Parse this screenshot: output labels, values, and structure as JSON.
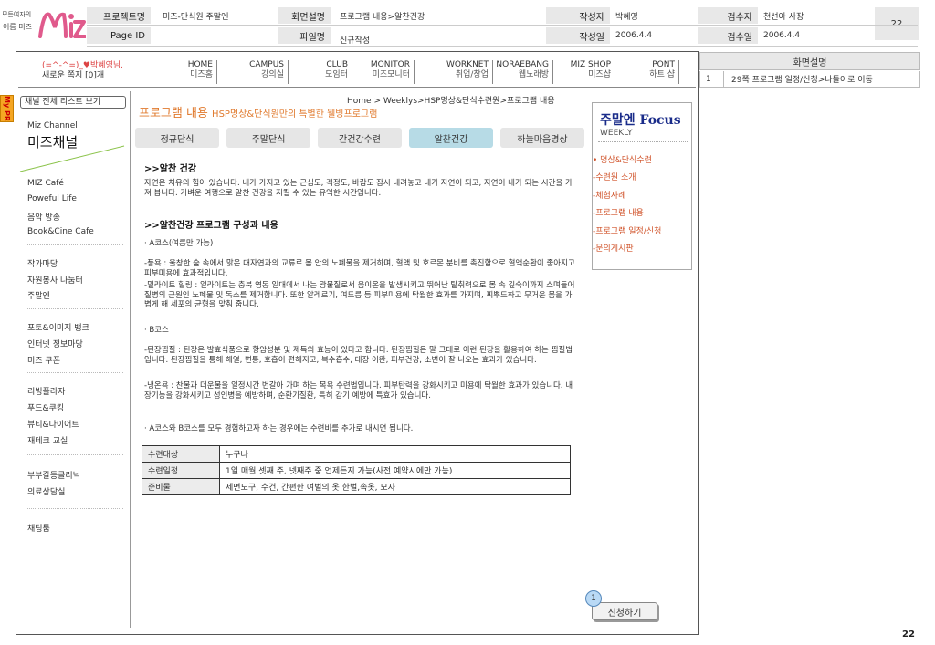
{
  "spec": {
    "logo": {
      "line1": "모든여자의",
      "line2": "이름 미즈",
      "mark": "Miz"
    },
    "project_label": "프로젝트명",
    "project_value": "미즈-단식원 주말엔",
    "pageid_label": "Page ID",
    "screen_label": "화면설명",
    "screen_value": "프로그램 내용>알찬건강",
    "file_label": "파일명",
    "file_value": "신규작성",
    "writer_label": "작성자",
    "writer_value": "박혜영",
    "date_label": "작성일",
    "date_value": "2006.4.4",
    "reviewer_label": "검수자",
    "reviewer_value": "천선아 사장",
    "review_date_label": "검수일",
    "review_date_value": "2006.4.4",
    "page_number": "22"
  },
  "mypr": "My PR",
  "topnav": {
    "user_line1": "(=^-^=)_♥박혜영님.",
    "user_line2": "새로운 쪽지 [0]개",
    "items": [
      {
        "en": "HOME",
        "ko": "미즈홈"
      },
      {
        "en": "CAMPUS",
        "ko": "강의실"
      },
      {
        "en": "CLUB",
        "ko": "모임터"
      },
      {
        "en": "MONITOR",
        "ko": "미즈모니터"
      },
      {
        "en": "WORKNET",
        "ko": "취업/창업"
      },
      {
        "en": "NORAEBANG",
        "ko": "웹노래방"
      },
      {
        "en": "MIZ SHOP",
        "ko": "미즈샵"
      },
      {
        "en": "PONT",
        "ko": "하트 샵"
      }
    ]
  },
  "sidebar": {
    "top_button": "채널 전체 리스트 보기",
    "channel": "Miz Channel",
    "title": "미즈채널",
    "groups": [
      [
        "MIZ Café",
        "Poweful Life",
        "음악 방송",
        "Book&Cine Cafe"
      ],
      [
        "작가마당",
        "자원봉사 나눔터",
        "주말엔"
      ],
      [
        "포토&이미지 뱅크",
        "인터넷 정보마당",
        "미즈 쿠폰"
      ],
      [
        "리빙플라자",
        "푸드&쿠킹",
        "뷰티&다이어트",
        "재테크 교실"
      ],
      [
        "부부갈등클리닉",
        "의료상담실"
      ],
      [
        "채팅룸"
      ]
    ]
  },
  "content": {
    "breadcrumb": "Home > Weeklys>HSP명상&단식수련원>프로그램 내용",
    "title": "프로그램 내용",
    "subtitle": "HSP명상&단식원만의 특별한 웰빙프로그램",
    "tabs": [
      "정규단식",
      "주말단식",
      "간건강수련",
      "알찬건강",
      "하늘마음명상"
    ],
    "active_tab": "알찬건강",
    "h1": ">>알찬 건강",
    "p1": "자연은 치유의 힘이 있습니다. 내가 가지고 있는 근심도, 걱정도, 바람도 잠시 내려놓고 내가 자연이 되고, 자연이 내가 되는 시간을 가져 봅니다. 가벼운 여행으로 알찬 건강을 지킬 수 있는 유익한 시간입니다.",
    "h2": ">>알찬건강 프로그램 구성과 내용",
    "course_a": "· A코스(여름만 가능)",
    "p2": "-풍욕 : 울창한 숲 속에서 맑은 대자연과의 교류로 몸 안의 노폐물을 제거하며, 혈액 및 호르몬 분비를 촉진함으로 혈액순환이 좋아지고 피부미용에 효과적입니다.",
    "p3": "-밀라이트 힐링 : 일라이트는 충북 영동 일대에서 나는 광물질로서 음이온을 발생시키고 뛰어난 탈취력으로 몸 속 깊숙이까지 스며들어 질병의 근원인 노폐물 및 독소를 제거합니다. 또한 알레르기, 여드름 등 피부미용에 탁월한 효과를 가지며, 찌뿌드하고 무거운 몸을 가볍게 해 세포의 균형을 맞춰 줍니다.",
    "course_b": "· B코스",
    "p4": "-된장찜질 : 된장은 발효식품으로 항암성분 및 제독의 효능이 있다고 합니다. 된장찜질은 말 그대로 이런 된장을 활용하여 하는 찜질법입니다. 된장찜질을 통해 해열, 변통, 호흡이 편해지고, 복수흡수, 대장 이완, 피부건강, 소변이 잘 나오는 효과가 있습니다.",
    "p5": "-냉온욕 : 찬물과 더운물을 일정시간 번갈아 가며 하는 목욕 수련법입니다. 피부탄력을 강화시키고 미용에 탁월한 효과가 있습니다. 내장기능을 강화시키고 성인병을 예방하며, 순환기질환, 특히 감기 예방에 특효가 있습니다.",
    "note": "· A코스와 B코스를 모두 경험하고자 하는 경우에는 수련비를 추가로 내시면 됩니다.",
    "table": [
      {
        "k": "수련대상",
        "v": "누구나"
      },
      {
        "k": "수련일정",
        "v": "1일 매월 셋째 주, 넷째주 중 언제든지 가능(사전 예약시에만 가능)"
      },
      {
        "k": "준비물",
        "v": "세면도구, 수건, 간편한 여벌의 옷 한벌,속옷, 모자"
      }
    ]
  },
  "focus": {
    "title": "주말엔",
    "title_en": "Focus",
    "weekly": "WEEKLY",
    "links": [
      "• 명상&단식수련",
      "-수련원 소개",
      "-체험사례",
      "-프로그램 내용",
      "-프로그램 일정/신청",
      "-문의게시판"
    ]
  },
  "apply_button": "신청하기",
  "badge": "1",
  "desc_panel": {
    "header": "화면설명",
    "rows": [
      {
        "n": "1",
        "text": "29쪽 프로그램 일정/신청>나들이로 이동"
      }
    ]
  },
  "footer_page": "22"
}
